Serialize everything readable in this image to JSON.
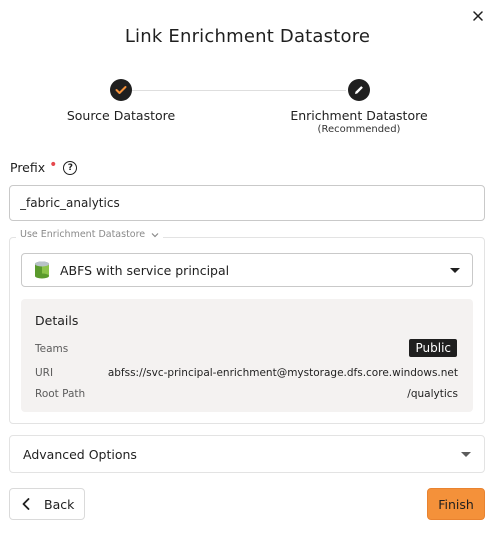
{
  "dialog": {
    "title": "Link Enrichment Datastore",
    "close_icon": "close-icon"
  },
  "stepper": {
    "steps": [
      {
        "label": "Source Datastore",
        "sublabel": "",
        "state": "complete",
        "icon": "check-icon"
      },
      {
        "label": "Enrichment Datastore",
        "sublabel": "(Recommended)",
        "state": "active",
        "icon": "pencil-icon"
      }
    ]
  },
  "prefix": {
    "label": "Prefix",
    "required": true,
    "help_icon": "help-icon",
    "value": "_fabric_analytics"
  },
  "enrichment": {
    "legend": "Use Enrichment Datastore",
    "selected": "ABFS with service principal",
    "selected_icon": "datastore-icon",
    "details": {
      "title": "Details",
      "rows": [
        {
          "label": "Teams",
          "value": "Public"
        },
        {
          "label": "URI",
          "value": "abfss://svc-principal-enrichment@mystorage.dfs.core.windows.net"
        },
        {
          "label": "Root Path",
          "value": "/qualytics"
        }
      ]
    }
  },
  "advanced": {
    "label": "Advanced Options"
  },
  "footer": {
    "back_label": "Back",
    "finish_label": "Finish"
  },
  "colors": {
    "accent": "#f4913a",
    "step_check": "#f4913a",
    "step_dot": "#1f1f1f",
    "required": "#e5484d",
    "details_bg": "#f4f2f1"
  }
}
